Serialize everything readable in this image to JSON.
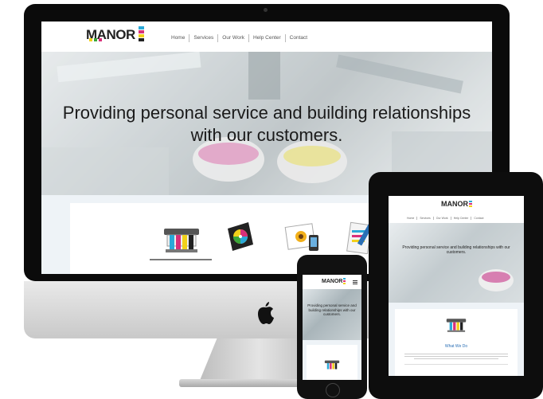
{
  "brand": {
    "logo_text": "MANOR",
    "logo_bar_colors": [
      "#2aa8d8",
      "#d8307a",
      "#f2d01a",
      "#222222"
    ],
    "logo_square_colors": [
      "#f2d01a",
      "#3aa63a",
      "#d8307a"
    ]
  },
  "nav": {
    "items": [
      {
        "label": "Home"
      },
      {
        "label": "Services"
      },
      {
        "label": "Our Work"
      },
      {
        "label": "Help Center"
      },
      {
        "label": "Contact"
      }
    ]
  },
  "hero": {
    "headline_line1": "Providing personal service and building relationships",
    "headline_line2": "with our customers."
  },
  "tablet": {
    "hero_headline": "Providing personal service and building relationships with our customers.",
    "section_title": "What We Do",
    "nav_icon": "hamburger-icon"
  },
  "phone": {
    "hero_headline": "Providing personal service and building relationships with our customers.",
    "nav_icon": "hamburger-icon"
  },
  "services": [
    {
      "icon": "printer-icon"
    },
    {
      "icon": "color-wheel-icon"
    },
    {
      "icon": "photos-icon"
    },
    {
      "icon": "clipboard-icon"
    }
  ],
  "colors": {
    "cyan": "#2aa8d8",
    "magenta": "#d8307a",
    "yellow": "#f2d01a",
    "heading_blue": "#2a6fb5"
  }
}
